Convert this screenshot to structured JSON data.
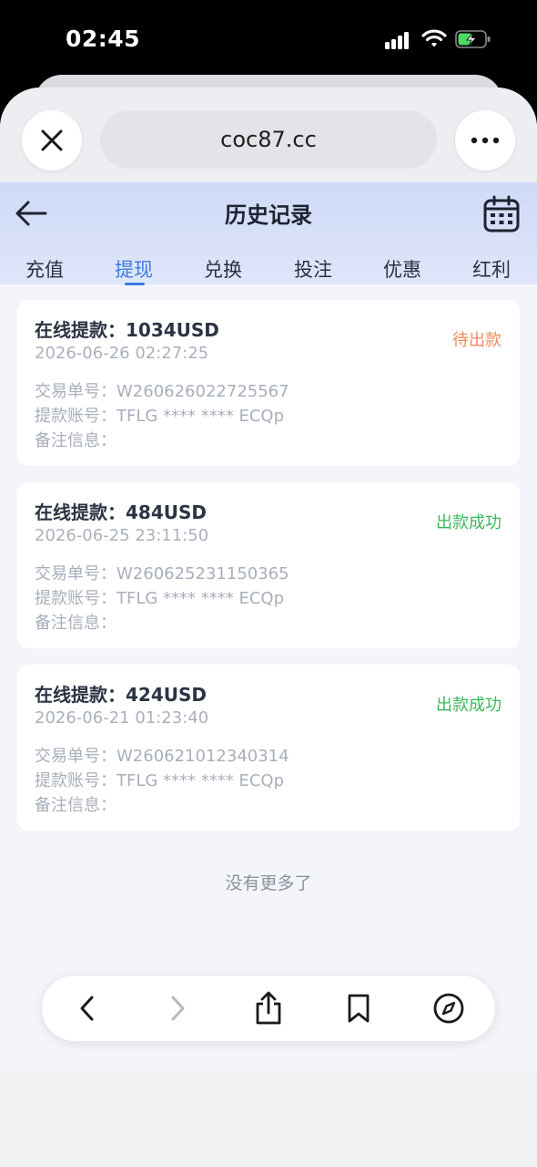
{
  "status_bar": {
    "time": "02:45"
  },
  "browser": {
    "url": "coc87.cc",
    "icons": [
      "close-icon",
      "more-icon"
    ]
  },
  "header": {
    "title": "历史记录",
    "icons": [
      "back-arrow-icon",
      "calendar-icon"
    ]
  },
  "tabs": [
    {
      "label": "充值",
      "active": false
    },
    {
      "label": "提现",
      "active": true
    },
    {
      "label": "兑换",
      "active": false
    },
    {
      "label": "投注",
      "active": false
    },
    {
      "label": "优惠",
      "active": false
    },
    {
      "label": "红利",
      "active": false
    }
  ],
  "records": [
    {
      "title": "在线提款：1034USD",
      "time": "2026-06-26 02:27:25",
      "status": "待出款",
      "status_color": "#f08a5d",
      "order": "交易单号：W260626022725567",
      "account": "提款账号：TFLG **** **** ECQp",
      "remark": "备注信息："
    },
    {
      "title": "在线提款：484USD",
      "time": "2026-06-25 23:11:50",
      "status": "出款成功",
      "status_color": "#38b85c",
      "order": "交易单号：W260625231150365",
      "account": "提款账号：TFLG **** **** ECQp",
      "remark": "备注信息："
    },
    {
      "title": "在线提款：424USD",
      "time": "2026-06-21 01:23:40",
      "status": "出款成功",
      "status_color": "#38b85c",
      "order": "交易单号：W260621012340314",
      "account": "提款账号：TFLG **** **** ECQp",
      "remark": "备注信息："
    }
  ],
  "footer_text": "没有更多了",
  "toolbar": {
    "icons": [
      "back-icon",
      "forward-icon",
      "share-icon",
      "bookmark-icon",
      "compass-icon"
    ]
  },
  "colors": {
    "accent": "#3d7bdc",
    "pending": "#f08a5d",
    "success": "#38b85c"
  }
}
